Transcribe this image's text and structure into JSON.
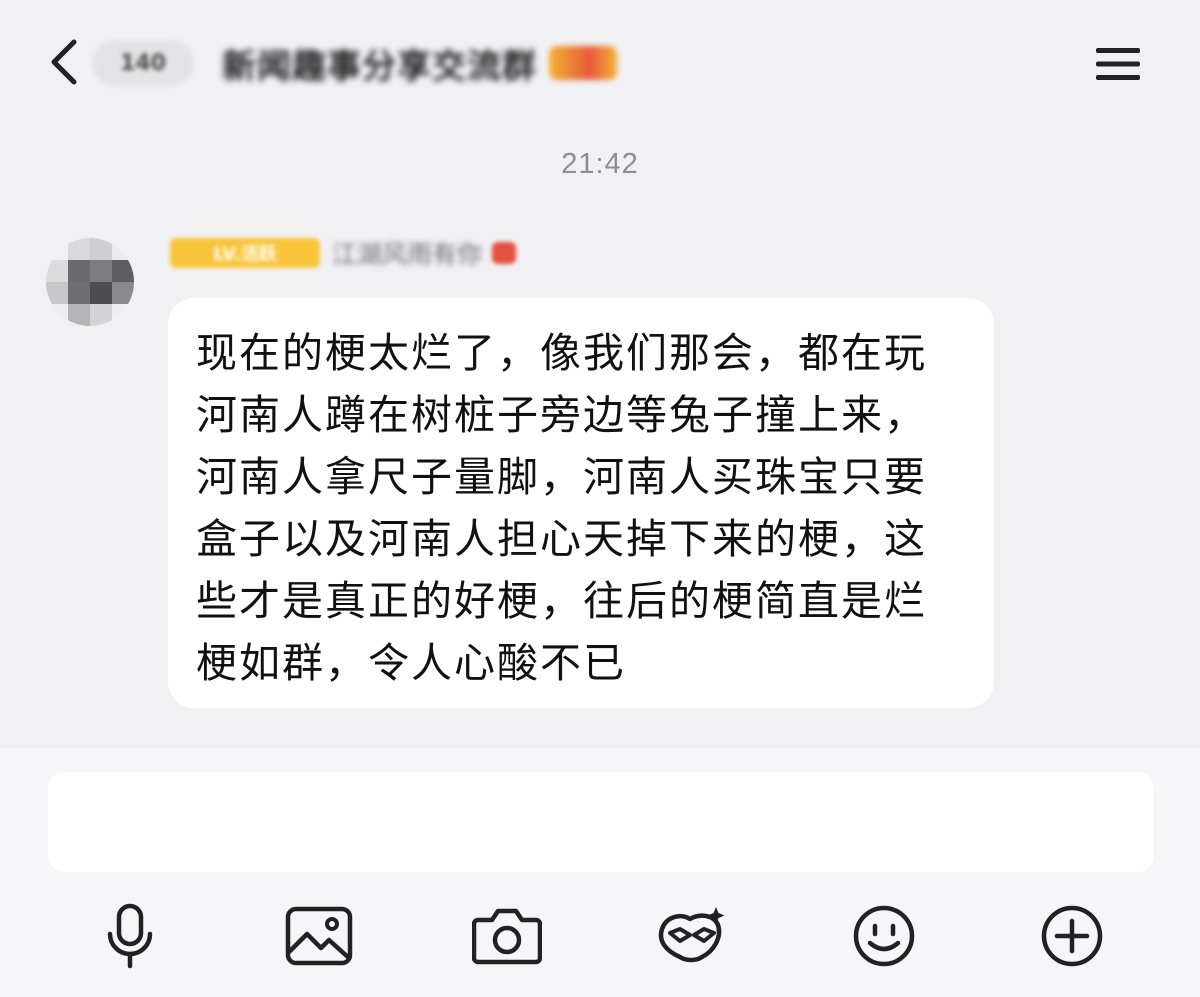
{
  "header": {
    "back_icon": "chevron-left-icon",
    "unread_count": "140",
    "title": "新闻趣事分享交流群",
    "menu_icon": "hamburger-menu-icon"
  },
  "timestamp": "21:42",
  "message": {
    "level_badge": "LV.活跃",
    "sender_name": "江湖风雨有你",
    "text": "现在的梗太烂了，像我们那会，都在玩河南人蹲在树桩子旁边等兔子撞上来，河南人拿尺子量脚，河南人买珠宝只要盒子以及河南人担心天掉下来的梗，这些才是真正的好梗，往后的梗简直是烂梗如群，令人心酸不已"
  },
  "composer": {
    "input_value": "",
    "tools": [
      "microphone-icon",
      "image-icon",
      "camera-icon",
      "mask-effect-icon",
      "emoji-icon",
      "plus-icon"
    ]
  },
  "colors": {
    "background": "#f1f1f4",
    "bubble": "#ffffff",
    "timestamp": "#8d8d92",
    "level_badge": "#f7c539"
  }
}
